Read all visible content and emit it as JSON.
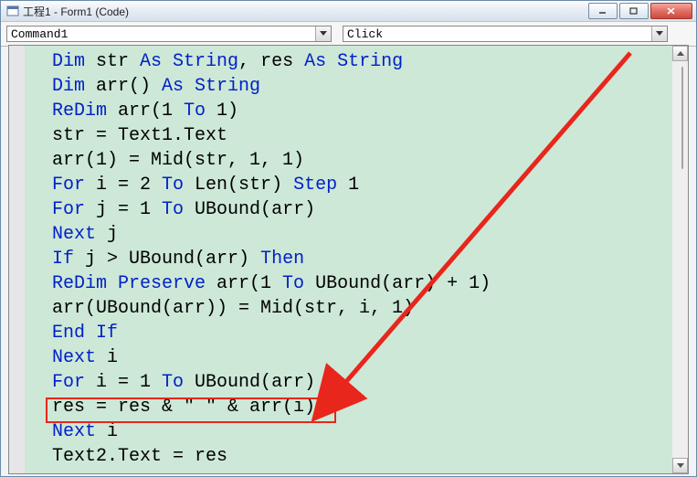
{
  "window": {
    "title": "工程1 - Form1 (Code)"
  },
  "dropdowns": {
    "object": "Command1",
    "procedure": "Click"
  },
  "code": {
    "l1": {
      "kw1": "Dim",
      "t1": " str ",
      "kw2": "As String",
      "t2": ", res ",
      "kw3": "As String"
    },
    "l2": {
      "kw1": "Dim",
      "t1": " arr() ",
      "kw2": "As String"
    },
    "l3": {
      "kw1": "ReDim",
      "t1": " arr(1 ",
      "kw2": "To",
      "t2": " 1)"
    },
    "l4": {
      "t1": "str = Text1.Text"
    },
    "l5": {
      "t1": "arr(1) = Mid(str, 1, 1)"
    },
    "l6": {
      "kw1": "For",
      "t1": " i = 2 ",
      "kw2": "To",
      "t2": " Len(str) ",
      "kw3": "Step",
      "t3": " 1"
    },
    "l7": {
      "kw1": "For",
      "t1": " j = 1 ",
      "kw2": "To",
      "t2": " UBound(arr)"
    },
    "l8": {
      "kw1": "Next",
      "t1": " j"
    },
    "l9": {
      "kw1": "If",
      "t1": " j > UBound(arr) ",
      "kw2": "Then"
    },
    "l10": {
      "kw1": "ReDim Preserve",
      "t1": " arr(1 ",
      "kw2": "To",
      "t2": " UBound(arr) + 1)"
    },
    "l11": {
      "t1": "arr(UBound(arr)) = Mid(str, i, 1)"
    },
    "l12": {
      "kw1": "End If"
    },
    "l13": {
      "kw1": "Next",
      "t1": " i"
    },
    "l14": {
      "kw1": "For",
      "t1": " i = 1 ",
      "kw2": "To",
      "t2": " UBound(arr)"
    },
    "l15": {
      "t1": "res = res & \" \" & arr(i)"
    },
    "l16": {
      "kw1": "Next",
      "t1": " i"
    },
    "l17": {
      "t1": "Text2.Text = res"
    }
  }
}
